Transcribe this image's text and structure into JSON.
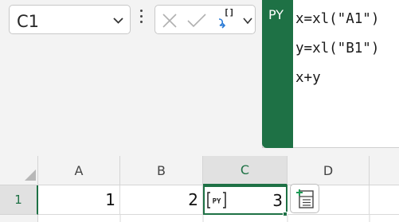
{
  "name_box": {
    "value": "C1",
    "icon": "chevron-down-icon"
  },
  "formula_toolbar": {
    "cancel_icon": "close-icon",
    "enter_icon": "check-icon",
    "python_output_icon": "python-output-icon",
    "python_output_label": "[]",
    "dropdown_icon": "chevron-down-icon"
  },
  "python_editor": {
    "badge": "PY",
    "lines": [
      "x=xl(\"A1\")",
      "y=xl(\"B1\")",
      "x+y"
    ]
  },
  "grid": {
    "columns": [
      "A",
      "B",
      "C",
      "D"
    ],
    "rows": [
      "1"
    ],
    "cells": {
      "A1": "1",
      "B1": "2",
      "C1": "3",
      "D1": ""
    },
    "py_cell_tag": "PY",
    "active_cell": "C1",
    "accent_color": "#1e7145"
  },
  "quick_analysis_icon": "card-add-icon"
}
